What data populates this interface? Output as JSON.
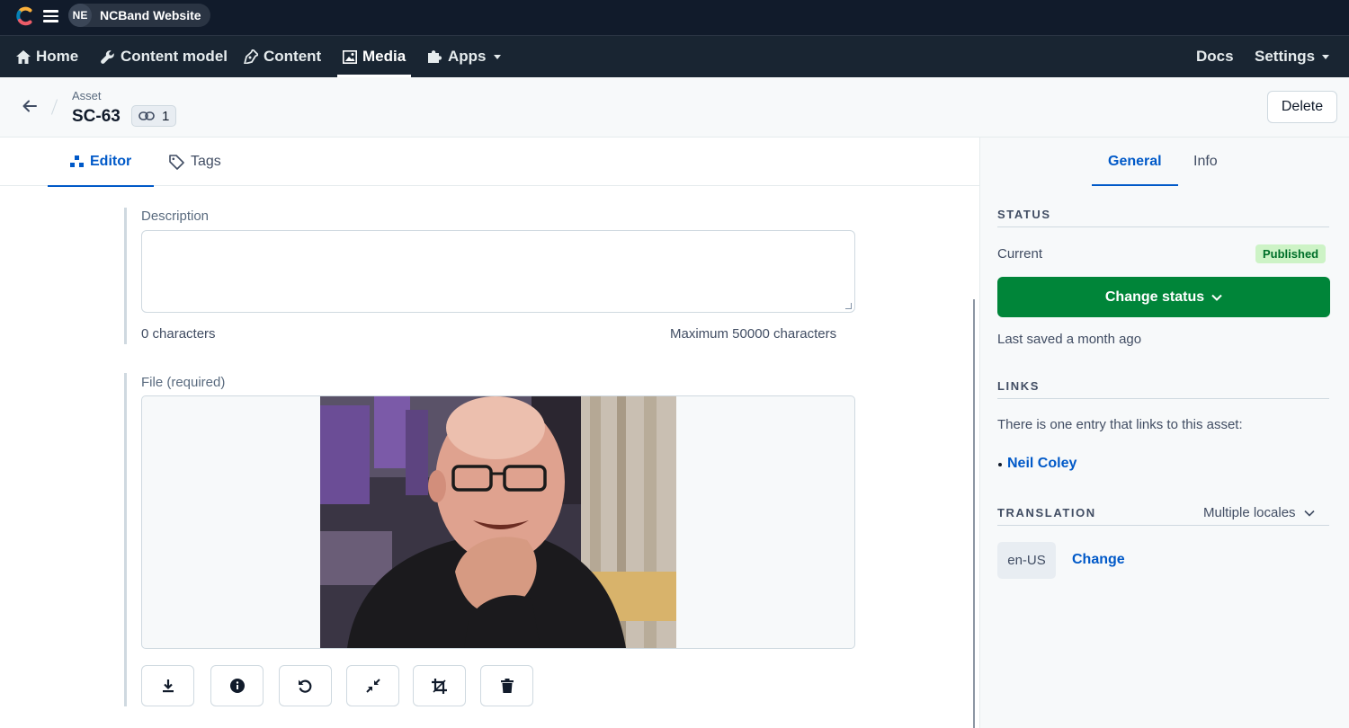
{
  "topbar": {
    "space_initials": "NE",
    "space_name": "NCBand Website"
  },
  "nav": {
    "items": [
      {
        "label": "Home",
        "icon": "home-icon"
      },
      {
        "label": "Content model",
        "icon": "wrench-icon"
      },
      {
        "label": "Content",
        "icon": "pen-nib-icon"
      },
      {
        "label": "Media",
        "icon": "image-icon",
        "active": true
      },
      {
        "label": "Apps",
        "icon": "puzzle-icon"
      }
    ],
    "right": {
      "docs": "Docs",
      "settings": "Settings"
    }
  },
  "header": {
    "breadcrumb": "Asset",
    "title": "SC-63",
    "link_count": "1",
    "delete_label": "Delete"
  },
  "tabs": {
    "editor": "Editor",
    "tags": "Tags"
  },
  "fields": {
    "description": {
      "label": "Description",
      "value": "",
      "char_count": "0 characters",
      "max": "Maximum 50000 characters"
    },
    "file": {
      "label": "File (required)"
    },
    "actions": [
      "download-icon",
      "info-icon",
      "rotate-icon",
      "shrink-icon",
      "crop-icon",
      "trash-icon"
    ]
  },
  "sidebar": {
    "tabs": {
      "general": "General",
      "info": "Info"
    },
    "status": {
      "title": "STATUS",
      "current_label": "Current",
      "badge": "Published",
      "change_button": "Change status",
      "last_saved": "Last saved a month ago"
    },
    "links": {
      "title": "LINKS",
      "text": "There is one entry that links to this asset:",
      "entry": "Neil Coley"
    },
    "translation": {
      "title": "TRANSLATION",
      "select": "Multiple locales",
      "locale": "en-US",
      "change": "Change"
    }
  },
  "colors": {
    "topbar": "#111b2b",
    "navbar": "#192532",
    "primary_blue": "#0059c8",
    "success_green": "#008539",
    "published_bg": "#cdf3c6"
  }
}
